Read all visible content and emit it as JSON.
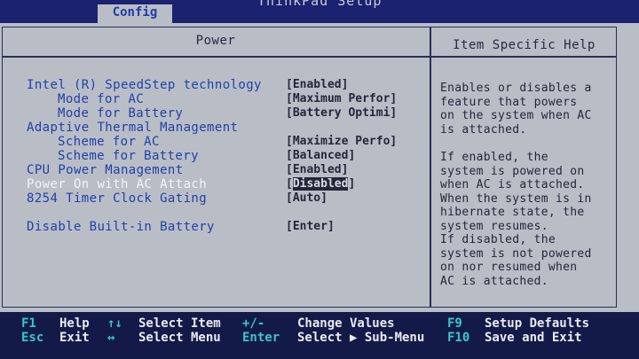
{
  "app": {
    "title": "ThinkPad Setup"
  },
  "tabs": [
    {
      "label": "Config"
    }
  ],
  "panel": {
    "title": "Power",
    "help_title": "Item Specific Help"
  },
  "items": [
    {
      "label": "Intel (R) SpeedStep technology",
      "value": "Enabled"
    },
    {
      "label": "Mode for AC",
      "value": "Maximum Perfor"
    },
    {
      "label": "Mode for Battery",
      "value": "Battery Optimi"
    },
    {
      "label": "Adaptive Thermal Management",
      "value": ""
    },
    {
      "label": "Scheme for AC",
      "value": "Maximize Perfo"
    },
    {
      "label": "Scheme for Battery",
      "value": "Balanced"
    },
    {
      "label": "CPU Power Management",
      "value": "Enabled"
    },
    {
      "label": "Power On with AC Attach",
      "value": "Disabled"
    },
    {
      "label": "8254 Timer Clock Gating",
      "value": "Auto"
    },
    {
      "label": "Disable Built-in Battery",
      "value": "Enter"
    }
  ],
  "help": [
    "Enables or disables a",
    "feature that powers",
    "on the system when AC",
    "is attached.",
    "If enabled, the",
    "system is powered on",
    "when AC is attached.",
    "When the system is in",
    "hibernate state, the",
    "system resumes.",
    "If disabled, the",
    "system is not powered",
    "on nor resumed when",
    "AC is attached."
  ],
  "footer": {
    "f1_key": "F1",
    "f1_label": "Help",
    "esc_key": "Esc",
    "esc_label": "Exit",
    "updown_key": "↑↓",
    "updown_label": "Select Item",
    "leftright_key": "↔",
    "leftright_label": "Select Menu",
    "plusminus_key": "+/-",
    "plusminus_label": "Change Values",
    "enter_key": "Enter",
    "enter_label": "Select ▶ Sub-Menu",
    "f9_key": "F9",
    "f9_label": "Setup Defaults",
    "f10_key": "F10",
    "f10_label": "Save and Exit"
  }
}
